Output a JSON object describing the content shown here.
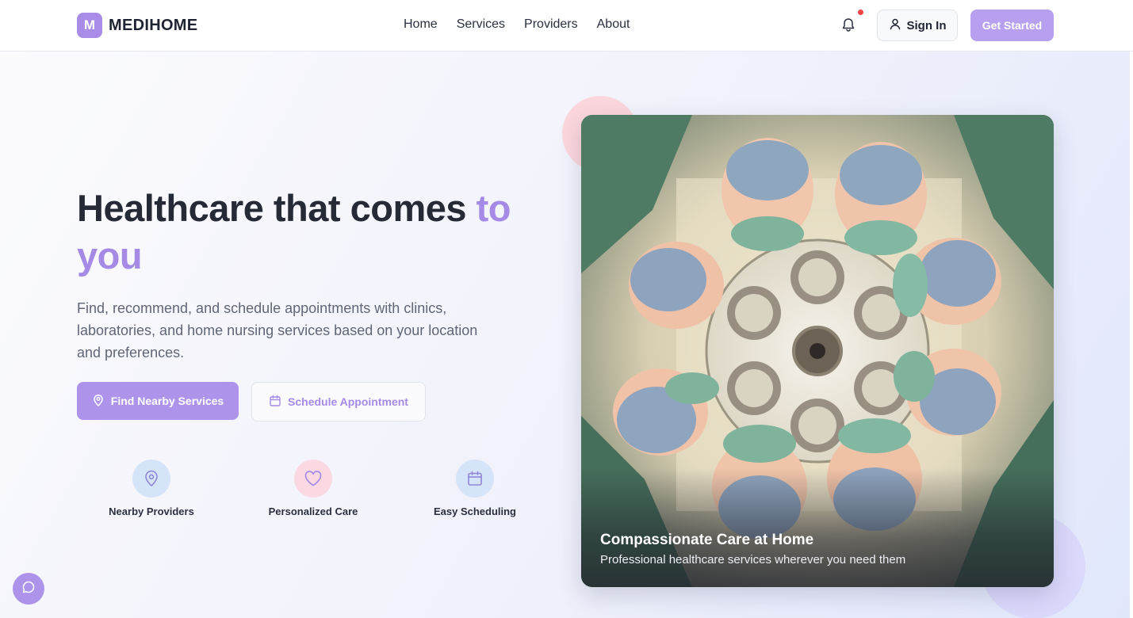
{
  "brand": {
    "mark": "M",
    "name": "MEDIHOME",
    "accent_color": "#a98ce8"
  },
  "nav": {
    "items": [
      {
        "label": "Home"
      },
      {
        "label": "Services"
      },
      {
        "label": "Providers"
      },
      {
        "label": "About"
      }
    ]
  },
  "header_actions": {
    "notifications_icon": "bell-icon",
    "has_unread": true,
    "sign_in_label": "Sign In",
    "sign_in_icon": "user-icon",
    "get_started_label": "Get Started"
  },
  "hero": {
    "headline_main": "Healthcare that comes ",
    "headline_accent": "to you",
    "description": "Find, recommend, and schedule appointments with clinics, laboratories, and home nursing services based on your location and preferences.",
    "primary_button": {
      "label": "Find Nearby Services",
      "icon": "map-pin-icon"
    },
    "secondary_button": {
      "label": "Schedule Appointment",
      "icon": "calendar-icon"
    },
    "features": [
      {
        "label": "Nearby Providers",
        "icon": "map-pin-icon"
      },
      {
        "label": "Personalized Care",
        "icon": "heart-icon"
      },
      {
        "label": "Easy Scheduling",
        "icon": "calendar-icon"
      }
    ]
  },
  "image_card": {
    "title": "Compassionate Care at Home",
    "subtitle": "Professional healthcare services wherever you need them"
  },
  "chat": {
    "icon": "chat-bubble-icon"
  }
}
